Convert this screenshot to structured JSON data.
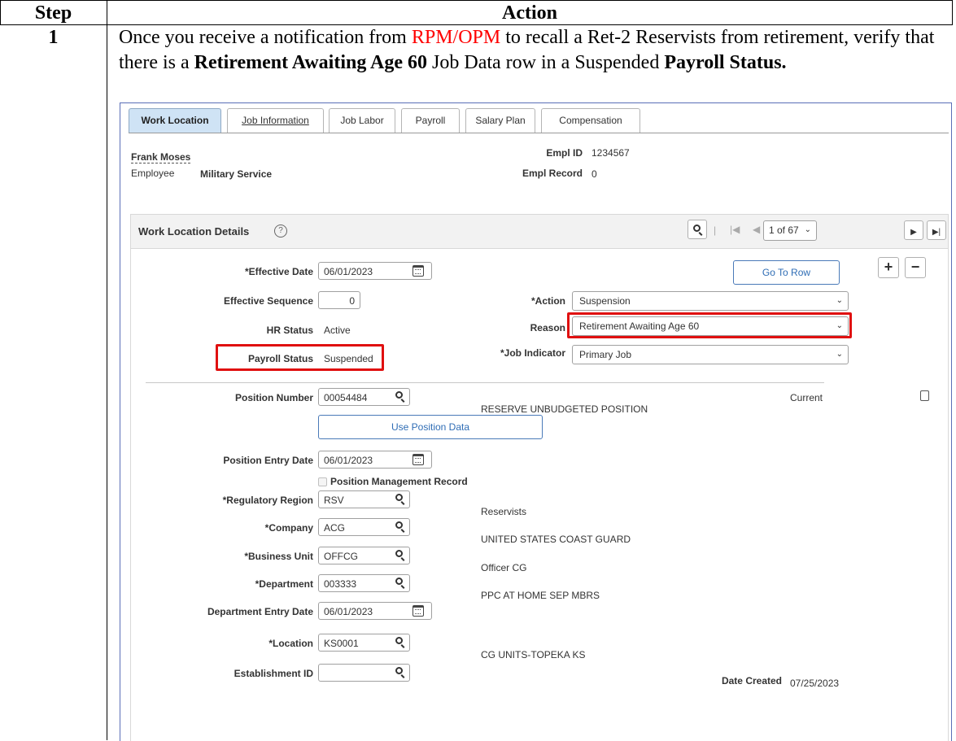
{
  "table": {
    "col_step": "Step",
    "col_action": "Action",
    "step_number": "1"
  },
  "action": {
    "part1": "Once you receive a notification from ",
    "rpm_opm": "RPM/OPM",
    "part2": " to recall a Ret-2 Reservists from retirement, verify that there is a ",
    "bold1": "Retirement Awaiting Age 60",
    "part3": " Job Data row in a Suspended ",
    "bold2": "Payroll Status."
  },
  "tabs": [
    {
      "label": "Work Location",
      "active": true
    },
    {
      "label": "Job Information",
      "active": false
    },
    {
      "label": "Job Labor",
      "active": false
    },
    {
      "label": "Payroll",
      "active": false
    },
    {
      "label": "Salary Plan",
      "active": false
    },
    {
      "label": "Compensation",
      "active": false
    }
  ],
  "header": {
    "employee_name": "Frank Moses",
    "employee_type": "Employee",
    "service": "Military Service",
    "empl_id_label": "Empl ID",
    "empl_id_value": "1234567",
    "empl_record_label": "Empl Record",
    "empl_record_value": "0"
  },
  "panel": {
    "title": "Work Location Details",
    "pager": "1 of 67",
    "go_to_row": "Go To Row"
  },
  "fields": {
    "effective_date_label": "*Effective Date",
    "effective_date_value": "06/01/2023",
    "effective_sequence_label": "Effective Sequence",
    "effective_sequence_value": "0",
    "hr_status_label": "HR Status",
    "hr_status_value": "Active",
    "payroll_status_label": "Payroll Status",
    "payroll_status_value": "Suspended",
    "action_label": "*Action",
    "action_value": "Suspension",
    "reason_label": "Reason",
    "reason_value": "Retirement Awaiting Age 60",
    "job_indicator_label": "*Job Indicator",
    "job_indicator_value": "Primary Job",
    "position_number_label": "Position Number",
    "position_number_value": "00054484",
    "position_desc": "RESERVE UNBUDGETED POSITION",
    "current_label": "Current",
    "use_position_data": "Use Position Data",
    "position_entry_date_label": "Position Entry Date",
    "position_entry_date_value": "06/01/2023",
    "position_mgmt_record": "Position Management Record",
    "regulatory_region_label": "*Regulatory Region",
    "regulatory_region_value": "RSV",
    "regulatory_region_desc": "Reservists",
    "company_label": "*Company",
    "company_value": "ACG",
    "company_desc": "UNITED STATES COAST GUARD",
    "business_unit_label": "*Business Unit",
    "business_unit_value": "OFFCG",
    "business_unit_desc": "Officer CG",
    "department_label": "*Department",
    "department_value": "003333",
    "department_desc": "PPC AT HOME SEP MBRS",
    "department_entry_date_label": "Department Entry Date",
    "department_entry_date_value": "06/01/2023",
    "location_label": "*Location",
    "location_value": "KS0001",
    "location_desc": "CG UNITS-TOPEKA KS",
    "establishment_id_label": "Establishment ID",
    "establishment_id_value": "",
    "date_created_label": "Date Created",
    "date_created_value": "07/25/2023"
  },
  "colors": {
    "highlight_red": "#e01010",
    "rpm_text": "#ff0000",
    "active_tab": "#cfe3f5",
    "link_blue": "#2f6db5"
  }
}
